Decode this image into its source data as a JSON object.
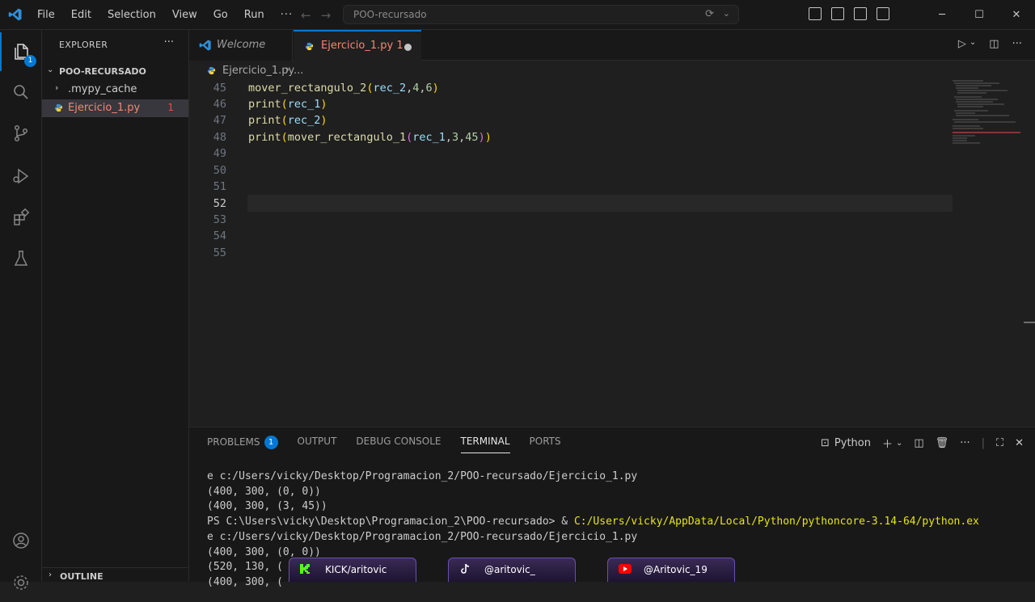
{
  "menu": {
    "items": [
      "File",
      "Edit",
      "Selection",
      "View",
      "Go",
      "Run"
    ],
    "more": "···"
  },
  "command_center": {
    "text": "POO-recursado"
  },
  "activity_bar": {
    "explorer_badge": "1"
  },
  "sidebar": {
    "title": "EXPLORER",
    "more": "···",
    "folder": "POO-RECURSADO",
    "items": [
      {
        "label": ".mypy_cache"
      },
      {
        "label": "Ejercicio_1.py",
        "problems": "1"
      }
    ],
    "outline": "OUTLINE"
  },
  "tabs": [
    {
      "label": "Welcome"
    },
    {
      "label": "Ejercicio_1.py 1"
    }
  ],
  "breadcrumb": {
    "file": "Ejercicio_1.py",
    "more": "..."
  },
  "editor": {
    "lines": [
      "45",
      "46",
      "47",
      "48",
      "49",
      "50",
      "51",
      "52",
      "53",
      "54",
      "55"
    ]
  },
  "panel": {
    "tabs": [
      {
        "label": "PROBLEMS",
        "badge": "1"
      },
      {
        "label": "OUTPUT"
      },
      {
        "label": "DEBUG CONSOLE"
      },
      {
        "label": "TERMINAL"
      },
      {
        "label": "PORTS"
      }
    ],
    "shell": "Python",
    "terminal": {
      "l1": "e c:/Users/vicky/Desktop/Programacion_2/POO-recursado/Ejercicio_1.py",
      "l2": "(400, 300, (0, 0))",
      "l3": "(400, 300, (3, 45))",
      "l4a": "PS C:\\Users\\vicky\\Desktop\\Programacion_2\\POO-recursado> & ",
      "l4b": "C:/Users/vicky/AppData/Local/Python/pythoncore-3.14-64/python.ex",
      "l5": "e c:/Users/vicky/Desktop/Programacion_2/POO-recursado/Ejercicio_1.py",
      "l6": "(400, 300, (0, 0))",
      "l7": "(520, 130, (",
      "l8": "(400, 300, ("
    }
  },
  "social": [
    {
      "label": "KICK/aritovic"
    },
    {
      "label": "@aritovic_"
    },
    {
      "label": "@Aritovic_19"
    }
  ],
  "colors": {
    "accent": "#0078d4",
    "error": "#f14c4c",
    "modified_tab": "#f48771"
  }
}
